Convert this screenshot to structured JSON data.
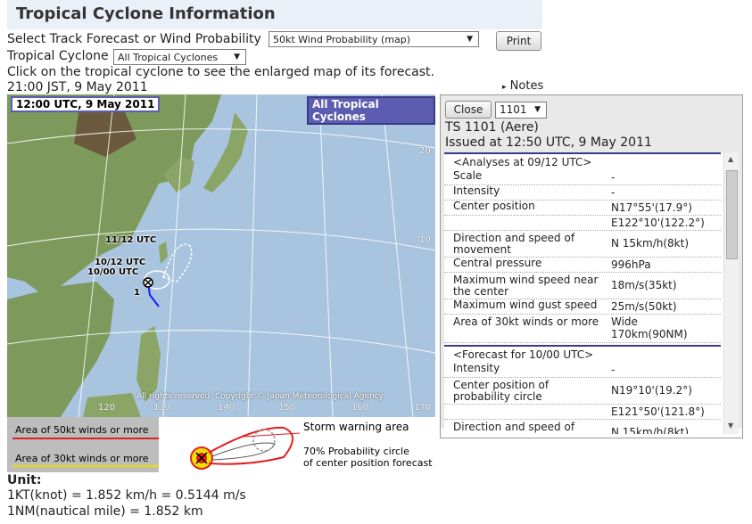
{
  "page": {
    "title": "Tropical Cyclone Information",
    "forecast_label": "Select Track Forecast or Wind Probability",
    "forecast_select": "50kt Wind Probability (map)",
    "print_label": "Print",
    "cyclone_label": "Tropical Cyclone",
    "cyclone_select": "All Tropical Cyclones",
    "instruction": "Click on the tropical cyclone to see the enlarged map of its forecast.",
    "timestamp": "21:00 JST, 9 May 2011",
    "notes_link": "Notes"
  },
  "map": {
    "time_label": "12:00 UTC, 9 May 2011",
    "scope_label": "All Tropical Cyclones",
    "date_labels": [
      "11/12 UTC",
      "10/12 UTC",
      "10/00 UTC"
    ],
    "storm_number": "1",
    "lat_ticks": [
      "20",
      "10"
    ],
    "lon_ticks": [
      "120",
      "130",
      "140",
      "150",
      "160",
      "170"
    ],
    "copyright": "All rights reserved. Copyright © Japan Meteorological Agency"
  },
  "legend": {
    "area50": "Area of 50kt winds or more",
    "area30": "Area of 30kt winds or more",
    "storm_warning": "Storm warning area",
    "prob_circle_1": "70% Probability circle",
    "prob_circle_2": "of center position forecast"
  },
  "units": {
    "heading": "Unit:",
    "knot": "1KT(knot) = 1.852 km/h = 0.5144 m/s",
    "nm": "1NM(nautical mile) = 1.852 km"
  },
  "panel": {
    "close_label": "Close",
    "id_select": "1101",
    "storm_name": "TS 1101 (Aere)",
    "issued": "Issued at 12:50 UTC, 9 May 2011",
    "analysis_header": "<Analyses at 09/12 UTC>",
    "analysis_rows": [
      {
        "k": "Scale",
        "v": "-"
      },
      {
        "k": "Intensity",
        "v": "-"
      },
      {
        "k": "Center position",
        "v": "N17°55'(17.9°)"
      },
      {
        "k": "",
        "v": "E122°10'(122.2°)"
      },
      {
        "k": "Direction and speed of movement",
        "v": "N 15km/h(8kt)"
      },
      {
        "k": "Central pressure",
        "v": "996hPa"
      },
      {
        "k": "Maximum wind speed near the center",
        "v": "18m/s(35kt)"
      },
      {
        "k": "Maximum wind gust speed",
        "v": "25m/s(50kt)"
      },
      {
        "k": "Area of 30kt winds or more",
        "v": "Wide\n170km(90NM)"
      }
    ],
    "forecast_header": "<Forecast for 10/00 UTC>",
    "forecast_rows": [
      {
        "k": "Intensity",
        "v": "-"
      },
      {
        "k": "Center position of probability circle",
        "v": "N19°10'(19.2°)"
      },
      {
        "k": "",
        "v": "E121°50'(121.8°)"
      },
      {
        "k": "Direction and speed of",
        "v": "N 15km/h(8kt)"
      }
    ]
  },
  "colors": {
    "accent": "#3a3a8a",
    "label_border": "#5c5cb0",
    "area50": "#e02020",
    "area30": "#e8e000"
  }
}
